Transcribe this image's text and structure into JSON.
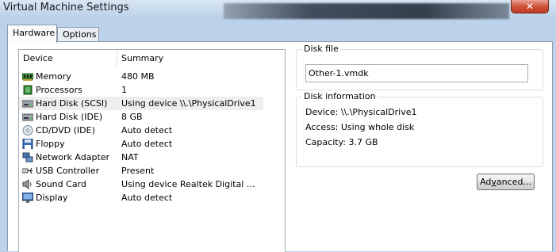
{
  "window": {
    "title": "Virtual Machine Settings",
    "close_glyph": "✕"
  },
  "tabs": [
    {
      "label": "Hardware",
      "active": true
    },
    {
      "label": "Options",
      "active": false
    }
  ],
  "device_table": {
    "columns": [
      "Device",
      "Summary"
    ],
    "rows": [
      {
        "icon": "memory-icon",
        "device": "Memory",
        "summary": "480 MB",
        "selected": false
      },
      {
        "icon": "processor-icon",
        "device": "Processors",
        "summary": "1",
        "selected": false
      },
      {
        "icon": "hard-disk-icon",
        "device": "Hard Disk (SCSI)",
        "summary": "Using device \\\\.\\PhysicalDrive1",
        "selected": true
      },
      {
        "icon": "hard-disk-icon",
        "device": "Hard Disk (IDE)",
        "summary": "8 GB",
        "selected": false
      },
      {
        "icon": "cd-dvd-icon",
        "device": "CD/DVD (IDE)",
        "summary": "Auto detect",
        "selected": false
      },
      {
        "icon": "floppy-icon",
        "device": "Floppy",
        "summary": "Auto detect",
        "selected": false
      },
      {
        "icon": "network-adapter-icon",
        "device": "Network Adapter",
        "summary": "NAT",
        "selected": false
      },
      {
        "icon": "usb-icon",
        "device": "USB Controller",
        "summary": "Present",
        "selected": false
      },
      {
        "icon": "sound-card-icon",
        "device": "Sound Card",
        "summary": "Using device Realtek Digital Outp...",
        "selected": false
      },
      {
        "icon": "display-icon",
        "device": "Display",
        "summary": "Auto detect",
        "selected": false
      }
    ]
  },
  "disk_file": {
    "label": "Disk file",
    "value": "Other-1.vmdk"
  },
  "disk_information": {
    "label": "Disk information",
    "device_line": "Device:  \\\\.\\PhysicalDrive1",
    "access_line": "Access:  Using whole disk",
    "capacity_line": "Capacity:  3.7 GB"
  },
  "advanced_button": {
    "pre": "Ad",
    "accel": "v",
    "post": "anced..."
  },
  "colors": {
    "selected_row": "#eeeeee",
    "window_frame": "#bcd2ea",
    "close_button": "#c13a22"
  }
}
